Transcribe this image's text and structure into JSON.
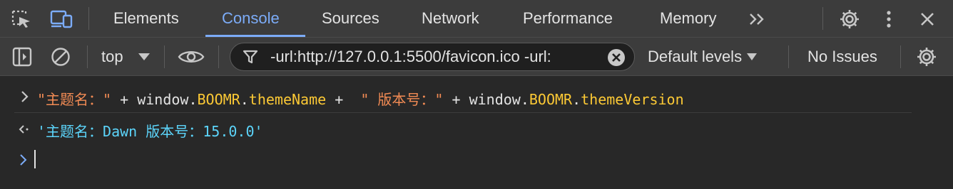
{
  "tabs": [
    "Elements",
    "Console",
    "Sources",
    "Network",
    "Performance",
    "Memory"
  ],
  "active_tab": "Console",
  "toolbar": {
    "context": "top",
    "filter_value": "-url:http://127.0.0.1:5500/favicon.ico -url:",
    "levels": "Default levels",
    "issues": "No Issues"
  },
  "console": {
    "input": {
      "s1": "\"主题名：\"",
      "p1": " + window.",
      "obj1": "BOOMR",
      "dot1": ".",
      "prop1": "themeName",
      "p2": " + ",
      "s2": " \" 版本号：\"",
      "p3": " + window.",
      "obj2": "BOOMR",
      "dot2": ".",
      "prop2": "themeVersion"
    },
    "result": "'主题名：Dawn 版本号：15.0.0'"
  },
  "colors": {
    "accent": "#7cacf8",
    "string": "#f28b54",
    "property": "#fcc935",
    "result": "#5cd5fb"
  }
}
